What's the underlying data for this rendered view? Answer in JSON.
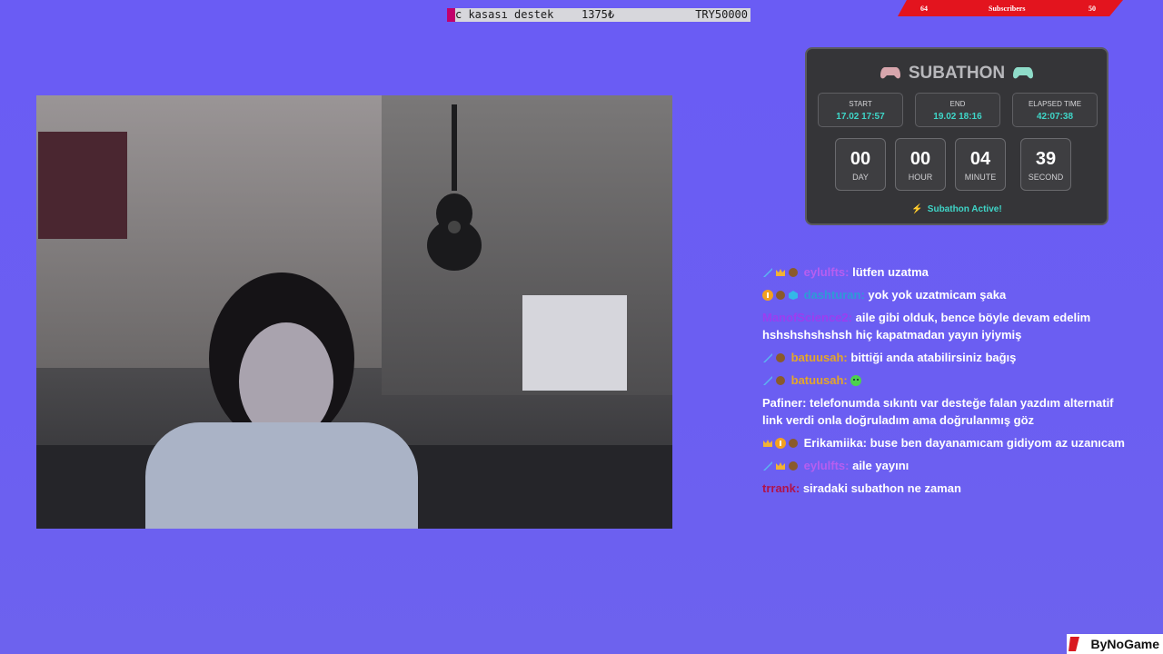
{
  "goal": {
    "name": "c kasası destek",
    "amount": "1375₺",
    "target": "TRY50000",
    "progress": 0.0275
  },
  "subs": {
    "current": "64",
    "label": "Subscribers",
    "goal": "50"
  },
  "subathon": {
    "title": "SUBATHON",
    "start_label": "START",
    "start_value": "17.02 17:57",
    "end_label": "END",
    "end_value": "19.02 18:16",
    "elapsed_label": "ELAPSED TIME",
    "elapsed_value": "42:07:38",
    "countdown": [
      {
        "value": "00",
        "unit": "DAY"
      },
      {
        "value": "00",
        "unit": "HOUR"
      },
      {
        "value": "04",
        "unit": "MINUTE"
      },
      {
        "value": "39",
        "unit": "SECOND"
      }
    ],
    "status": "Subathon Active!"
  },
  "chat": [
    {
      "user": "eylulfts:",
      "text": "lütfen uzatma",
      "color": "#b65ef0"
    },
    {
      "user": "dashturan:",
      "text": "yok yok uzatmicam şaka",
      "color": "#2e9bd6"
    },
    {
      "user": "ManofScience2:",
      "text": "aile gibi olduk, bence böyle devam edelim hshshshshshsh hiç kapatmadan yayın iyiymiş",
      "color": "#9c3df0"
    },
    {
      "user": "batuusah:",
      "text": "bittiği anda atabilirsiniz bağış",
      "color": "#e3a62a"
    },
    {
      "user": "batuusah:",
      "text": "",
      "color": "#e3a62a"
    },
    {
      "user": "Pafiner:",
      "text": "telefonumda sıkıntı var desteğe falan yazdım alternatif link verdi onla doğruladım ama doğrulanmış göz",
      "color": "#ffffff"
    },
    {
      "user": "Erikamiika:",
      "text": "buse ben dayanamıcam gidiyom az uzanıcam",
      "color": "#ffffff"
    },
    {
      "user": "eylulfts:",
      "text": "aile yayını",
      "color": "#b65ef0"
    },
    {
      "user": "trrank:",
      "text": "siradaki subathon ne zaman",
      "color": "#b0134a"
    }
  ],
  "watermark": {
    "text": "ByNoGame"
  },
  "colors": {
    "background": "#6a5cf4",
    "accent_teal": "#3fd6c8",
    "subs_red": "#e3141e",
    "goal_fill": "#c2006c"
  }
}
